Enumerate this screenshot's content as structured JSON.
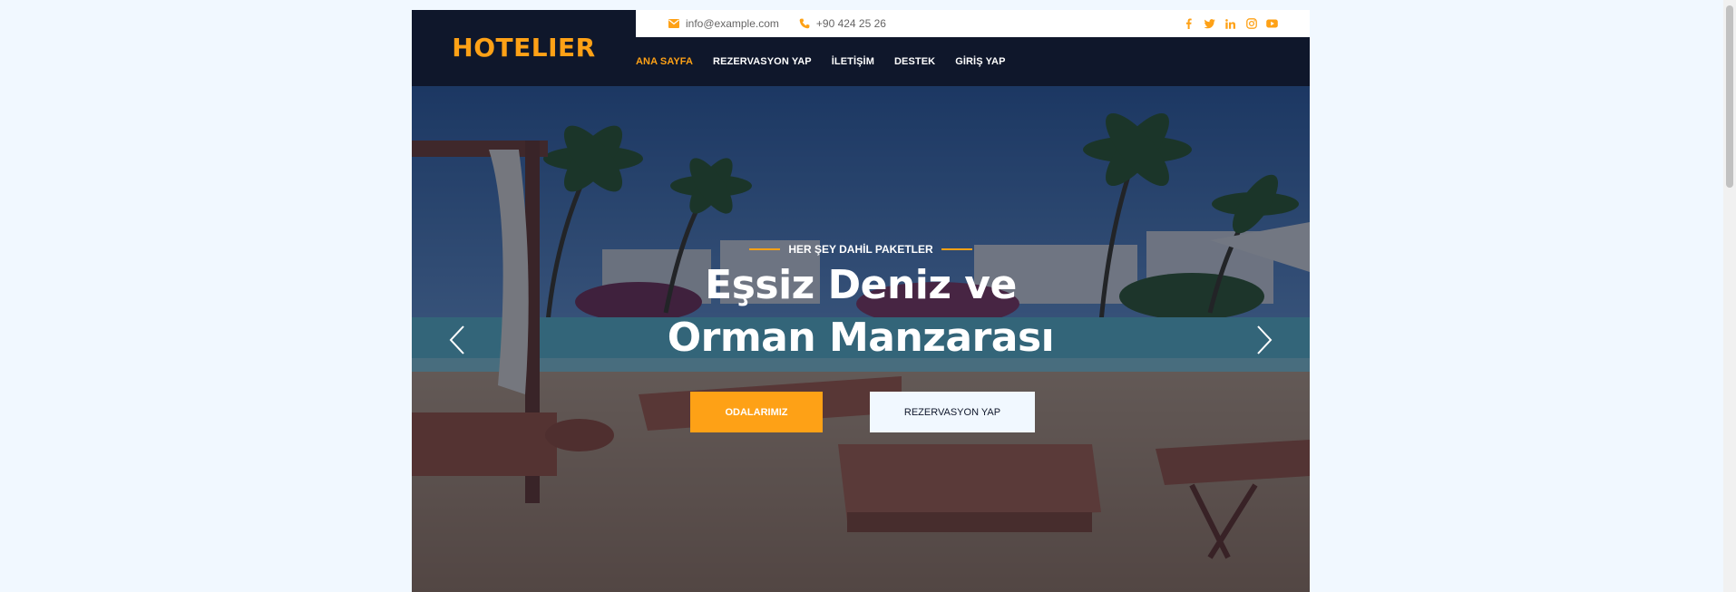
{
  "brand": {
    "name": "HOTELIER"
  },
  "topbar": {
    "email": "info@example.com",
    "phone": "+90 424 25 26",
    "socials": [
      "facebook-icon",
      "twitter-icon",
      "linkedin-icon",
      "instagram-icon",
      "youtube-icon"
    ]
  },
  "nav": {
    "items": [
      {
        "label": "ANA SAYFA",
        "active": true
      },
      {
        "label": "REZERVASYON YAP"
      },
      {
        "label": "İLETİŞİM"
      },
      {
        "label": "DESTEK"
      },
      {
        "label": "GİRİŞ YAP"
      }
    ]
  },
  "hero": {
    "eyebrow": "HER ŞEY DAHİL PAKETLER",
    "title_line1": "Eşsiz Deniz ve",
    "title_line2": "Orman Manzarası",
    "primary_button": "ODALARIMIZ",
    "secondary_button": "REZERVASYON YAP"
  },
  "colors": {
    "accent": "#fea116",
    "dark": "#0f172b",
    "light": "#f1f8ff"
  }
}
